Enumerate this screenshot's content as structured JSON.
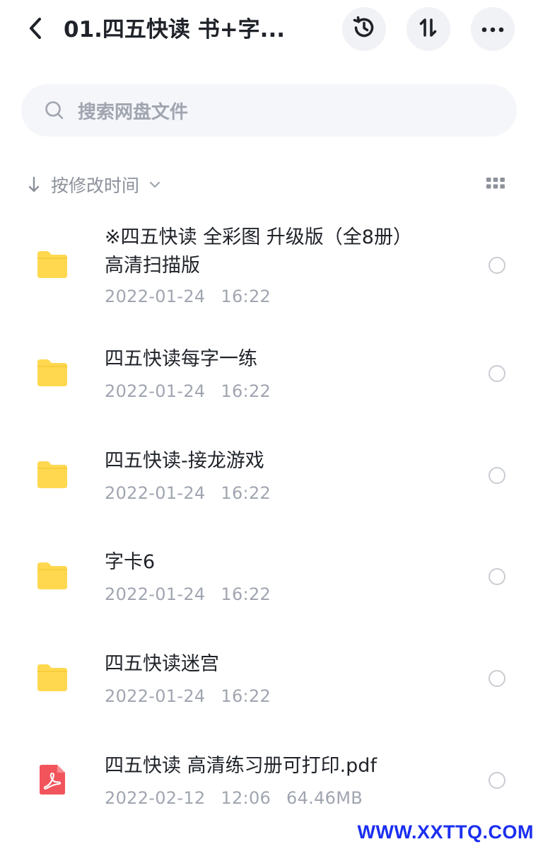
{
  "header": {
    "title": "01.四五快读 书+字...",
    "back_icon": "chevron-left-icon",
    "history_icon": "history-icon",
    "sort_icon": "sort-swap-icon",
    "more_icon": "more-horizontal-icon"
  },
  "search": {
    "placeholder": "搜索网盘文件",
    "icon": "search-icon"
  },
  "sort_bar": {
    "label": "按修改时间",
    "arrow_icon": "arrow-down-icon",
    "dropdown_icon": "chevron-down-icon",
    "view_icon": "grid-view-icon"
  },
  "files": [
    {
      "type": "folder",
      "name_line1": "※四五快读 全彩图 升级版（全8册）",
      "name_line2": "高清扫描版",
      "date": "2022-01-24",
      "time": "16:22",
      "size": ""
    },
    {
      "type": "folder",
      "name_line1": "四五快读每字一练",
      "date": "2022-01-24",
      "time": "16:22",
      "size": ""
    },
    {
      "type": "folder",
      "name_line1": "四五快读-接龙游戏",
      "date": "2022-01-24",
      "time": "16:22",
      "size": ""
    },
    {
      "type": "folder",
      "name_line1": "字卡6",
      "date": "2022-01-24",
      "time": "16:22",
      "size": ""
    },
    {
      "type": "folder",
      "name_line1": "四五快读迷宫",
      "date": "2022-01-24",
      "time": "16:22",
      "size": ""
    },
    {
      "type": "pdf",
      "name_line1": "四五快读 高清练习册可打印.pdf",
      "date": "2022-02-12",
      "time": "12:06",
      "size": "64.46MB"
    }
  ],
  "watermark": "WWW.XXTTQ.COM",
  "colors": {
    "folder": "#ffd84f",
    "pdf": "#f2545b",
    "button_bg": "#f1f2f6",
    "search_bg": "#f5f6fa",
    "watermark": "#1a2ef0"
  }
}
